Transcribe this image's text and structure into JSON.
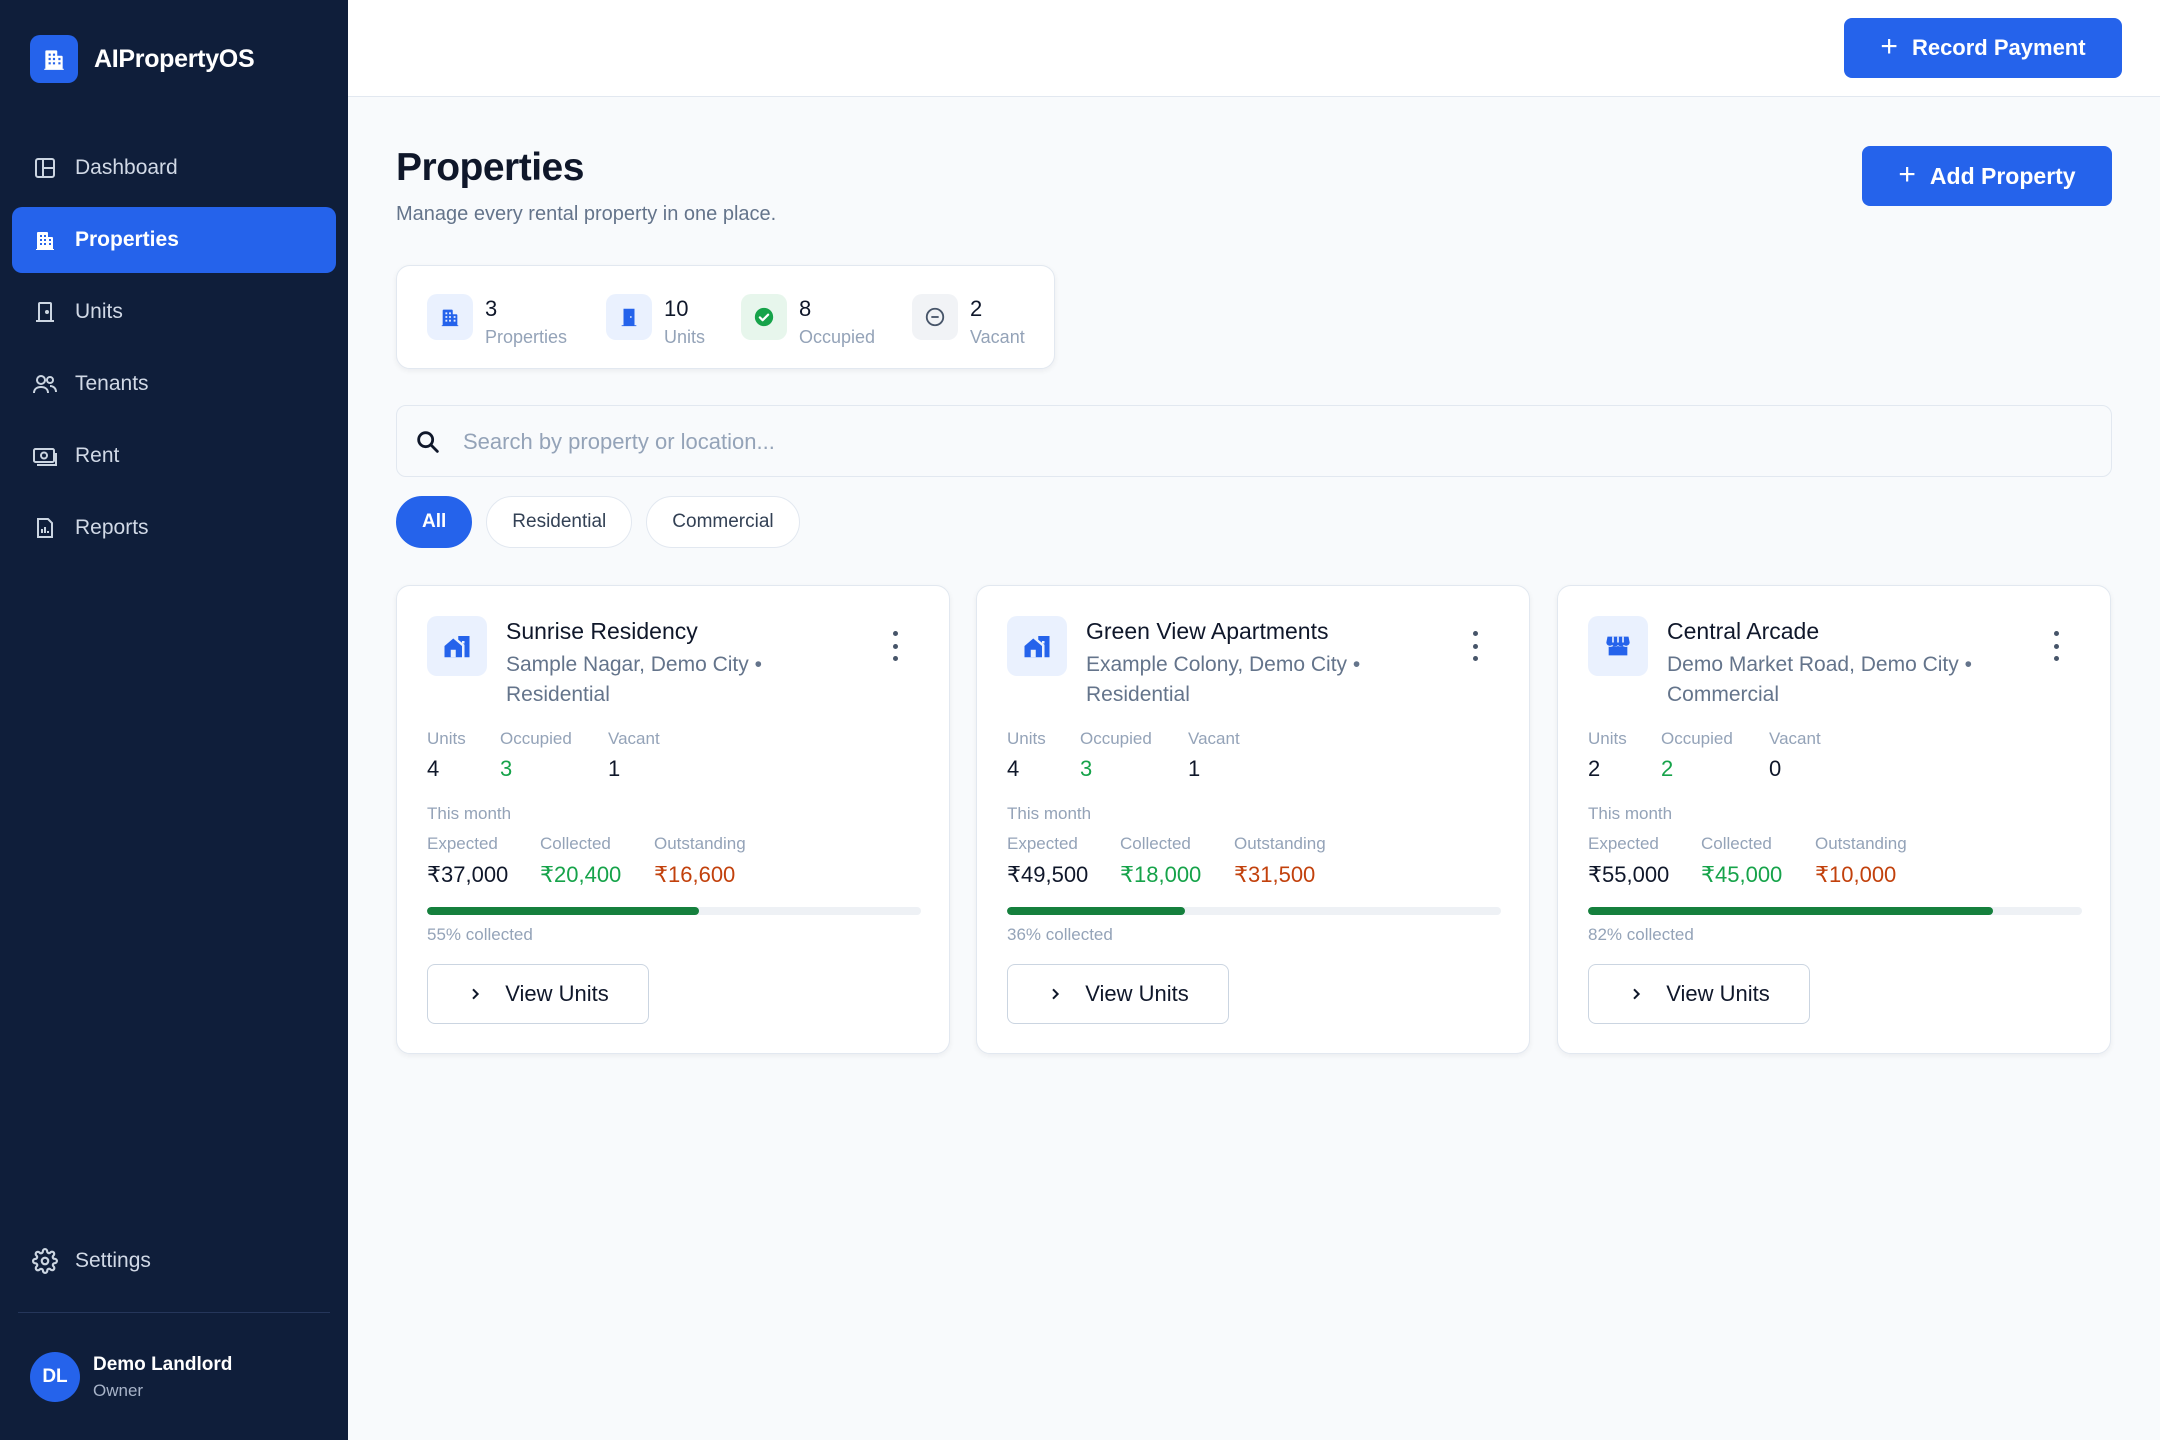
{
  "app": {
    "name": "AIPropertyOS"
  },
  "nav": {
    "items": [
      {
        "label": "Dashboard",
        "icon": "dashboard-icon"
      },
      {
        "label": "Properties",
        "icon": "buildings-icon",
        "active": true
      },
      {
        "label": "Units",
        "icon": "door-icon"
      },
      {
        "label": "Tenants",
        "icon": "users-icon"
      },
      {
        "label": "Rent",
        "icon": "cash-icon"
      },
      {
        "label": "Reports",
        "icon": "report-icon"
      }
    ],
    "settings_label": "Settings"
  },
  "user": {
    "initials": "DL",
    "name": "Demo Landlord",
    "role": "Owner"
  },
  "topbar": {
    "record_payment_label": "Record Payment"
  },
  "page": {
    "title": "Properties",
    "subtitle": "Manage every rental property in one place.",
    "add_property_label": "Add Property"
  },
  "stats": [
    {
      "value": "3",
      "label": "Properties"
    },
    {
      "value": "10",
      "label": "Units"
    },
    {
      "value": "8",
      "label": "Occupied"
    },
    {
      "value": "2",
      "label": "Vacant"
    }
  ],
  "search": {
    "placeholder": "Search by property or location..."
  },
  "filters": [
    "All",
    "Residential",
    "Commercial"
  ],
  "card_labels": {
    "units": "Units",
    "occupied": "Occupied",
    "vacant": "Vacant",
    "this_month": "This month",
    "expected": "Expected",
    "collected": "Collected",
    "outstanding": "Outstanding",
    "view_units": "View Units"
  },
  "properties": [
    {
      "name": "Sunrise Residency",
      "location": "Sample Nagar, Demo City • Residential",
      "units": "4",
      "occupied": "3",
      "vacant": "1",
      "expected": "₹37,000",
      "collected": "₹20,400",
      "outstanding": "₹16,600",
      "collected_pct": 55,
      "pct_text": "55% collected"
    },
    {
      "name": "Green View Apartments",
      "location": "Example Colony, Demo City • Residential",
      "units": "4",
      "occupied": "3",
      "vacant": "1",
      "expected": "₹49,500",
      "collected": "₹18,000",
      "outstanding": "₹31,500",
      "collected_pct": 36,
      "pct_text": "36% collected"
    },
    {
      "name": "Central Arcade",
      "location": "Demo Market Road, Demo City • Commercial",
      "units": "2",
      "occupied": "2",
      "vacant": "0",
      "expected": "₹55,000",
      "collected": "₹45,000",
      "outstanding": "₹10,000",
      "collected_pct": 82,
      "pct_text": "82% collected"
    }
  ],
  "colors": {
    "sidebar_bg": "#0f1e3a",
    "primary": "#2563eb",
    "success": "#16a34a",
    "warning": "#c2410c"
  }
}
